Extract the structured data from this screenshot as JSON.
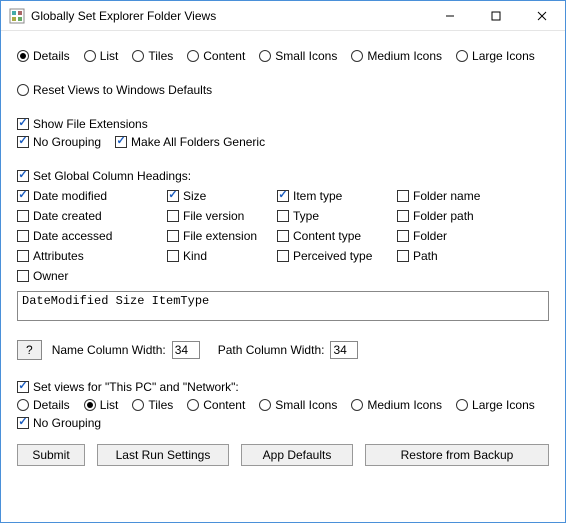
{
  "window": {
    "title": "Globally Set Explorer Folder Views"
  },
  "viewOptions": {
    "items": [
      {
        "label": "Details",
        "selected": true
      },
      {
        "label": "List",
        "selected": false
      },
      {
        "label": "Tiles",
        "selected": false
      },
      {
        "label": "Content",
        "selected": false
      },
      {
        "label": "Small Icons",
        "selected": false
      },
      {
        "label": "Medium Icons",
        "selected": false
      },
      {
        "label": "Large Icons",
        "selected": false
      }
    ]
  },
  "resetOption": {
    "label": "Reset Views to Windows Defaults",
    "selected": false
  },
  "mainChecks": {
    "showFileExtensions": {
      "label": "Show File Extensions",
      "checked": true
    },
    "noGrouping": {
      "label": "No Grouping",
      "checked": true
    },
    "makeGeneric": {
      "label": "Make All Folders Generic",
      "checked": true
    }
  },
  "globalHeadings": {
    "toggle": {
      "label": "Set Global Column Headings:",
      "checked": true
    },
    "columns": [
      {
        "label": "Date modified",
        "checked": true
      },
      {
        "label": "Size",
        "checked": true
      },
      {
        "label": "Item type",
        "checked": true
      },
      {
        "label": "Folder name",
        "checked": false
      },
      {
        "label": "Date created",
        "checked": false
      },
      {
        "label": "File version",
        "checked": false
      },
      {
        "label": "Type",
        "checked": false
      },
      {
        "label": "Folder path",
        "checked": false
      },
      {
        "label": "Date accessed",
        "checked": false
      },
      {
        "label": "File extension",
        "checked": false
      },
      {
        "label": "Content type",
        "checked": false
      },
      {
        "label": "Folder",
        "checked": false
      },
      {
        "label": "Attributes",
        "checked": false
      },
      {
        "label": "Kind",
        "checked": false
      },
      {
        "label": "Perceived type",
        "checked": false
      },
      {
        "label": "Path",
        "checked": false
      },
      {
        "label": "Owner",
        "checked": false
      }
    ],
    "textValue": "DateModified Size ItemType"
  },
  "widths": {
    "helpLabel": "?",
    "nameLabel": "Name Column Width:",
    "nameValue": "34",
    "pathLabel": "Path Column Width:",
    "pathValue": "34"
  },
  "thisPC": {
    "toggle": {
      "label": "Set views for \"This PC\" and \"Network\":",
      "checked": true
    },
    "views": [
      {
        "label": "Details",
        "selected": false
      },
      {
        "label": "List",
        "selected": true
      },
      {
        "label": "Tiles",
        "selected": false
      },
      {
        "label": "Content",
        "selected": false
      },
      {
        "label": "Small Icons",
        "selected": false
      },
      {
        "label": "Medium Icons",
        "selected": false
      },
      {
        "label": "Large Icons",
        "selected": false
      }
    ],
    "noGrouping": {
      "label": "No Grouping",
      "checked": true
    }
  },
  "buttons": {
    "submit": "Submit",
    "lastRun": "Last Run Settings",
    "appDefaults": "App Defaults",
    "restore": "Restore from Backup"
  }
}
